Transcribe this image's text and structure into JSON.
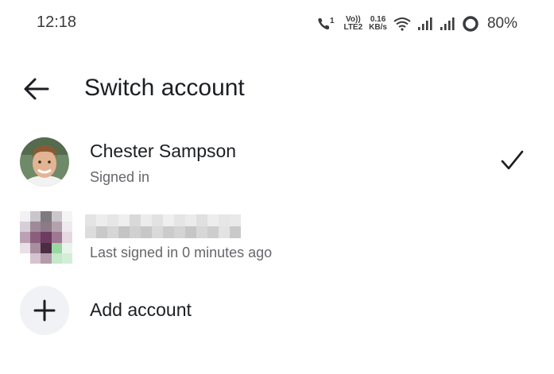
{
  "status_bar": {
    "time": "12:18",
    "sim_label_top": "Vo))",
    "sim_label_bottom": "LTE2",
    "speed_top": "0.16",
    "speed_bottom": "KB/s",
    "call_sim": "1",
    "battery": "80%"
  },
  "header": {
    "title": "Switch account"
  },
  "accounts": [
    {
      "name": "Chester Sampson",
      "status": "Signed in",
      "active": true
    },
    {
      "name": "",
      "status": "Last signed in 0 minutes ago",
      "active": false,
      "name_obscured": true
    }
  ],
  "add_account": {
    "label": "Add account"
  },
  "colors": {
    "text": "#1c1e21",
    "secondary": "#65676b",
    "add_bg": "#f0f2f5"
  }
}
